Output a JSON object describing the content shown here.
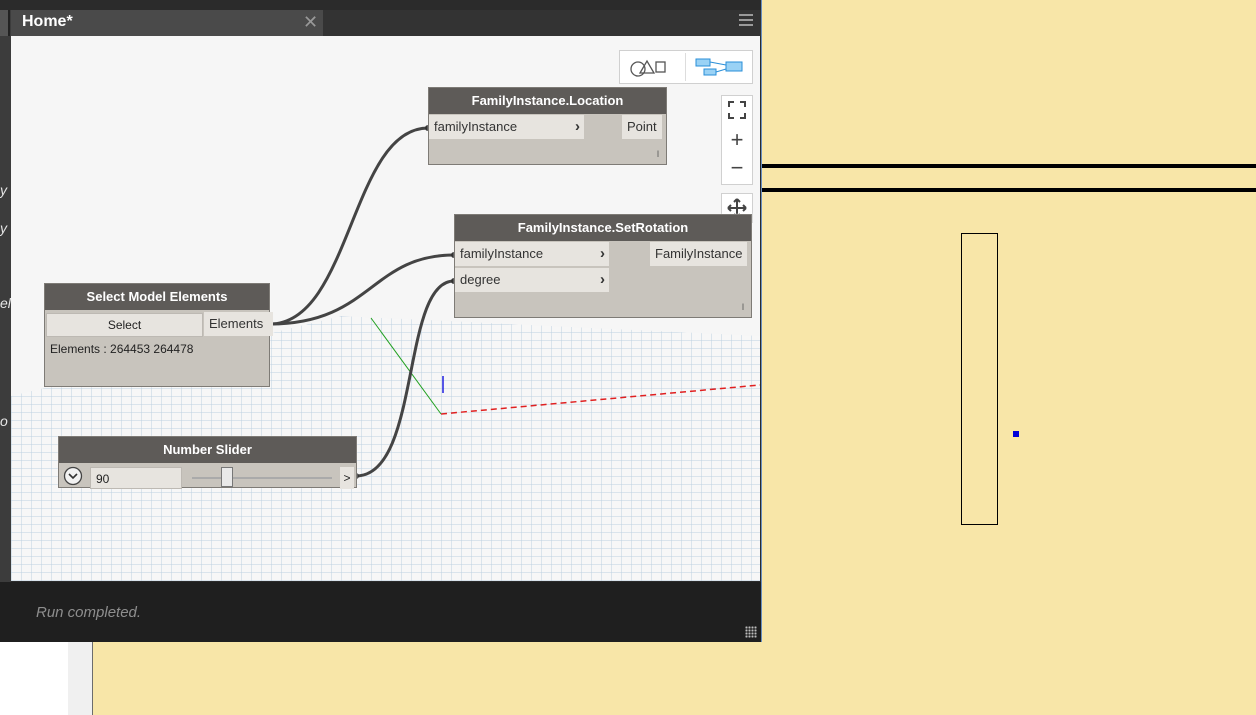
{
  "window": {
    "tab_title": "Home*",
    "tab_close": "✕",
    "status": "Run completed.",
    "left_fragments": [
      "y",
      "y",
      "el",
      "o"
    ]
  },
  "view_toggle": {
    "geometry_icon": "geometry-view-icon",
    "graph_icon": "graph-view-icon"
  },
  "zoom": {
    "fit_icon": "zoom-fit-icon",
    "zoom_in": "+",
    "zoom_out": "−",
    "pan_icon": "pan-icon"
  },
  "nodes": {
    "select_model_elements": {
      "title": "Select Model Elements",
      "button": "Select",
      "output": "Elements",
      "value": "Elements : 264453 264478"
    },
    "location": {
      "title": "FamilyInstance.Location",
      "input": "familyInstance",
      "output": "Point",
      "foot": "l"
    },
    "set_rotation": {
      "title": "FamilyInstance.SetRotation",
      "inputs": [
        "familyInstance",
        "degree"
      ],
      "output": "FamilyInstance",
      "foot": "l"
    },
    "number_slider": {
      "title": "Number Slider",
      "value": "90",
      "output": ">",
      "level_fraction": 0.25
    }
  },
  "colors": {
    "revit_background": "#f8e6a8",
    "node_header": "#5e5b58",
    "node_body": "#c8c4bd",
    "wire": "#444444",
    "axis_x": "#e02020",
    "axis_y": "#20a020",
    "axis_z": "#2020e0"
  }
}
